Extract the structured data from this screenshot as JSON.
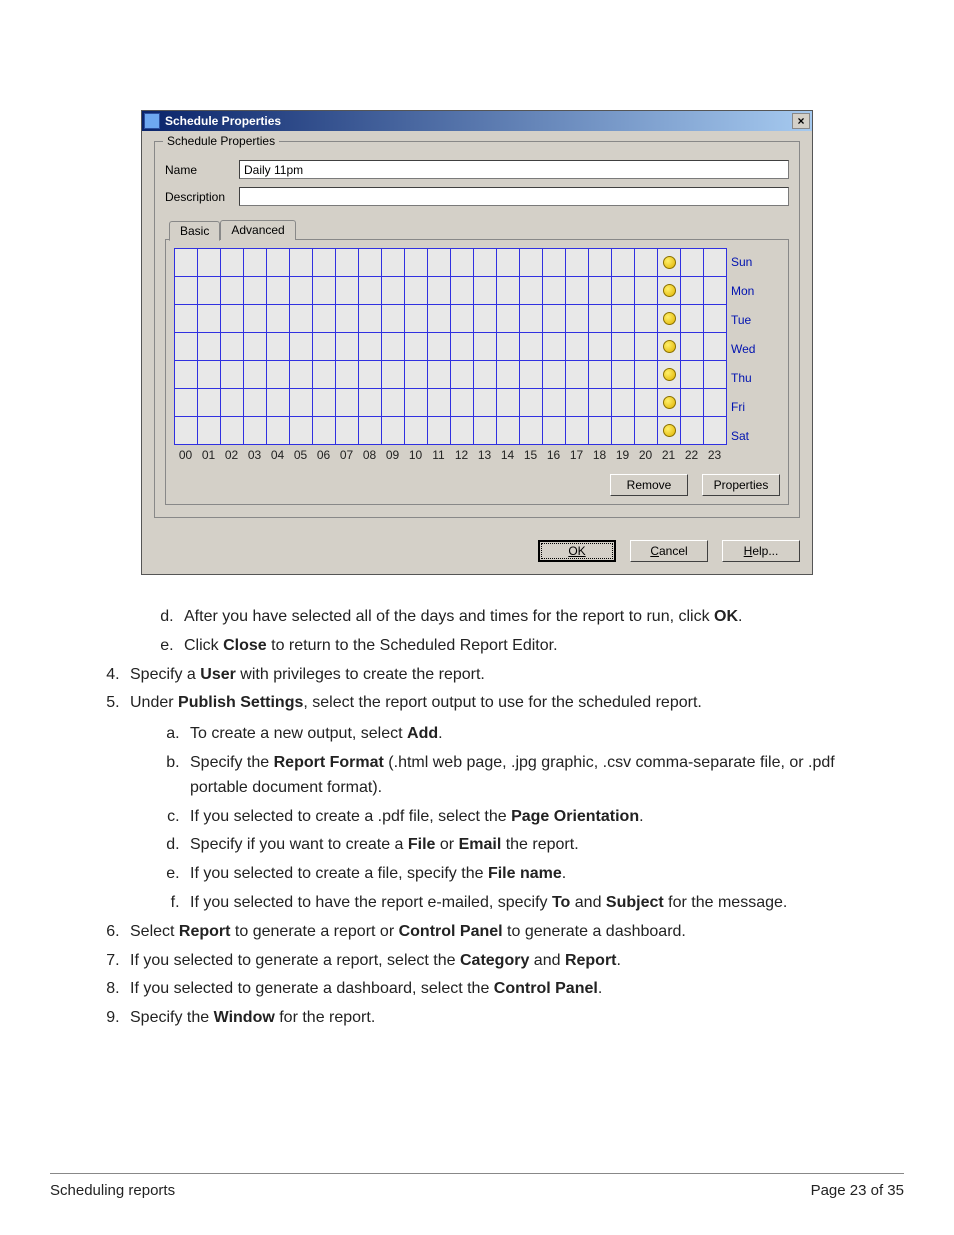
{
  "dialog": {
    "title": "Schedule Properties",
    "group_legend": "Schedule Properties",
    "name_label": "Name",
    "name_value": "Daily 11pm",
    "desc_label": "Description",
    "desc_value": "",
    "tabs": {
      "basic": "Basic",
      "advanced": "Advanced"
    },
    "days": [
      "Sun",
      "Mon",
      "Tue",
      "Wed",
      "Thu",
      "Fri",
      "Sat"
    ],
    "hours": [
      "00",
      "01",
      "02",
      "03",
      "04",
      "05",
      "06",
      "07",
      "08",
      "09",
      "10",
      "11",
      "12",
      "13",
      "14",
      "15",
      "16",
      "17",
      "18",
      "19",
      "20",
      "21",
      "22",
      "23"
    ],
    "selected_hour": 21,
    "remove_btn": "Remove",
    "properties_btn": "Properties",
    "ok_btn": "OK",
    "cancel_btn": "Cancel",
    "help_btn": "Help..."
  },
  "doc": {
    "d_text_a": "After you have selected all of the days and times for the report to run, click ",
    "d_text_b": "OK",
    "d_text_c": ".",
    "e_text_a": "Click ",
    "e_text_b": "Close",
    "e_text_c": " to return to the Scheduled Report Editor.",
    "s4_a": "Specify a ",
    "s4_b": "User",
    "s4_c": " with privileges to create the report.",
    "s5_a": "Under ",
    "s5_b": "Publish Settings",
    "s5_c": ", select the report output to use for the scheduled report.",
    "s5a_a": "To create a new output, select ",
    "s5a_b": "Add",
    "s5a_c": ".",
    "s5b_a": "Specify the ",
    "s5b_b": "Report Format",
    "s5b_c": " (.html web page, .jpg graphic, .csv comma-separate file, or .pdf portable document format).",
    "s5c_a": "If you selected to create a .pdf file, select the ",
    "s5c_b": "Page Orientation",
    "s5c_c": ".",
    "s5d_a": "Specify if you want to create a ",
    "s5d_b": "File",
    "s5d_c": " or ",
    "s5d_d": "Email",
    "s5d_e": " the report.",
    "s5e_a": "If you selected to create a file, specify the ",
    "s5e_b": "File name",
    "s5e_c": ".",
    "s5f_a": "If you selected to have the report e-mailed, specify ",
    "s5f_b": "To",
    "s5f_c": " and ",
    "s5f_d": "Subject",
    "s5f_e": " for the message.",
    "s6_a": "Select ",
    "s6_b": "Report",
    "s6_c": " to generate a report or ",
    "s6_d": "Control Panel",
    "s6_e": " to generate a dashboard.",
    "s7_a": "If you selected to generate a report, select the ",
    "s7_b": "Category",
    "s7_c": " and ",
    "s7_d": "Report",
    "s7_e": ".",
    "s8_a": "If you selected to generate a dashboard, select the ",
    "s8_b": "Control Panel",
    "s8_c": ".",
    "s9_a": "Specify the ",
    "s9_b": "Window",
    "s9_c": " for the report."
  },
  "footer": {
    "left": "Scheduling reports",
    "right": "Page 23 of 35"
  }
}
